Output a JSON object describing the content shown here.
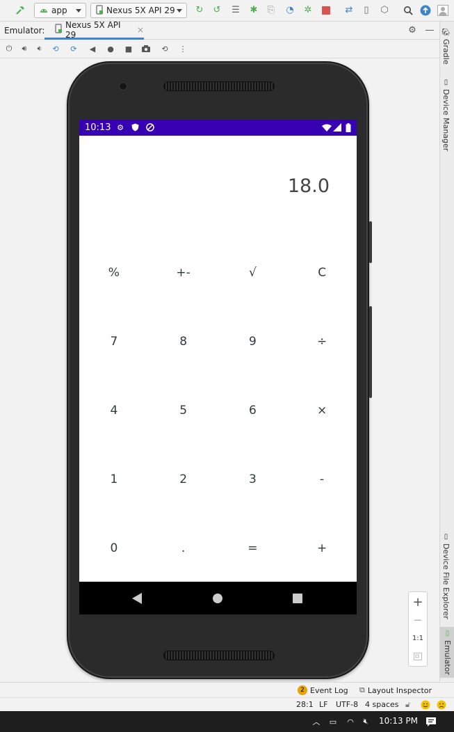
{
  "toolbar": {
    "run_config": "app",
    "device": "Nexus 5X API 29",
    "icons": [
      "hammer-icon",
      "android-icon",
      "phone-icon",
      "rerun-icon",
      "apply-changes-icon",
      "apply-code-changes-icon",
      "debug-icon",
      "attach-debugger-icon",
      "profile-icon",
      "debug-attach-icon",
      "stop-icon",
      "sync-icon",
      "avd-manager-icon",
      "sdk-manager-icon",
      "search-icon",
      "update-icon",
      "account-icon"
    ]
  },
  "tabs": {
    "prefix": "Emulator:",
    "active_tab": "Nexus 5X API 29",
    "close_glyph": "×"
  },
  "emulator_tools": [
    "power-icon",
    "volume-up-icon",
    "volume-down-icon",
    "rotate-left-icon",
    "rotate-right-icon",
    "back-icon",
    "home-icon",
    "overview-icon",
    "screenshot-icon",
    "snapshot-icon",
    "more-icon"
  ],
  "side_tabs": {
    "gradle": "Gradle",
    "device_manager": "Device Manager",
    "device_file_explorer": "Device File Explorer",
    "emulator": "Emulator"
  },
  "phone": {
    "status_time": "10:13",
    "display_value": "18.0",
    "keys": [
      [
        "%",
        "+-",
        "√",
        "C"
      ],
      [
        "7",
        "8",
        "9",
        "÷"
      ],
      [
        "4",
        "5",
        "6",
        "×"
      ],
      [
        "1",
        "2",
        "3",
        "-"
      ],
      [
        "0",
        ".",
        "=",
        "+"
      ]
    ]
  },
  "zoom": {
    "zoom_in": "+",
    "zoom_out": "−",
    "one_to_one": "1:1"
  },
  "bottom_bar": {
    "event_log_count": "2",
    "event_log": "Event Log",
    "layout_inspector": "Layout Inspector"
  },
  "status_line": {
    "position": "28:1",
    "line_ending": "LF",
    "encoding": "UTF-8",
    "indent": "4 spaces"
  },
  "taskbar": {
    "time": "10:13 PM"
  },
  "colors": {
    "status_bar": "#3700b3",
    "tab_underline": "#4083c9",
    "stop": "#d9534f",
    "run_green": "#4caf50"
  }
}
